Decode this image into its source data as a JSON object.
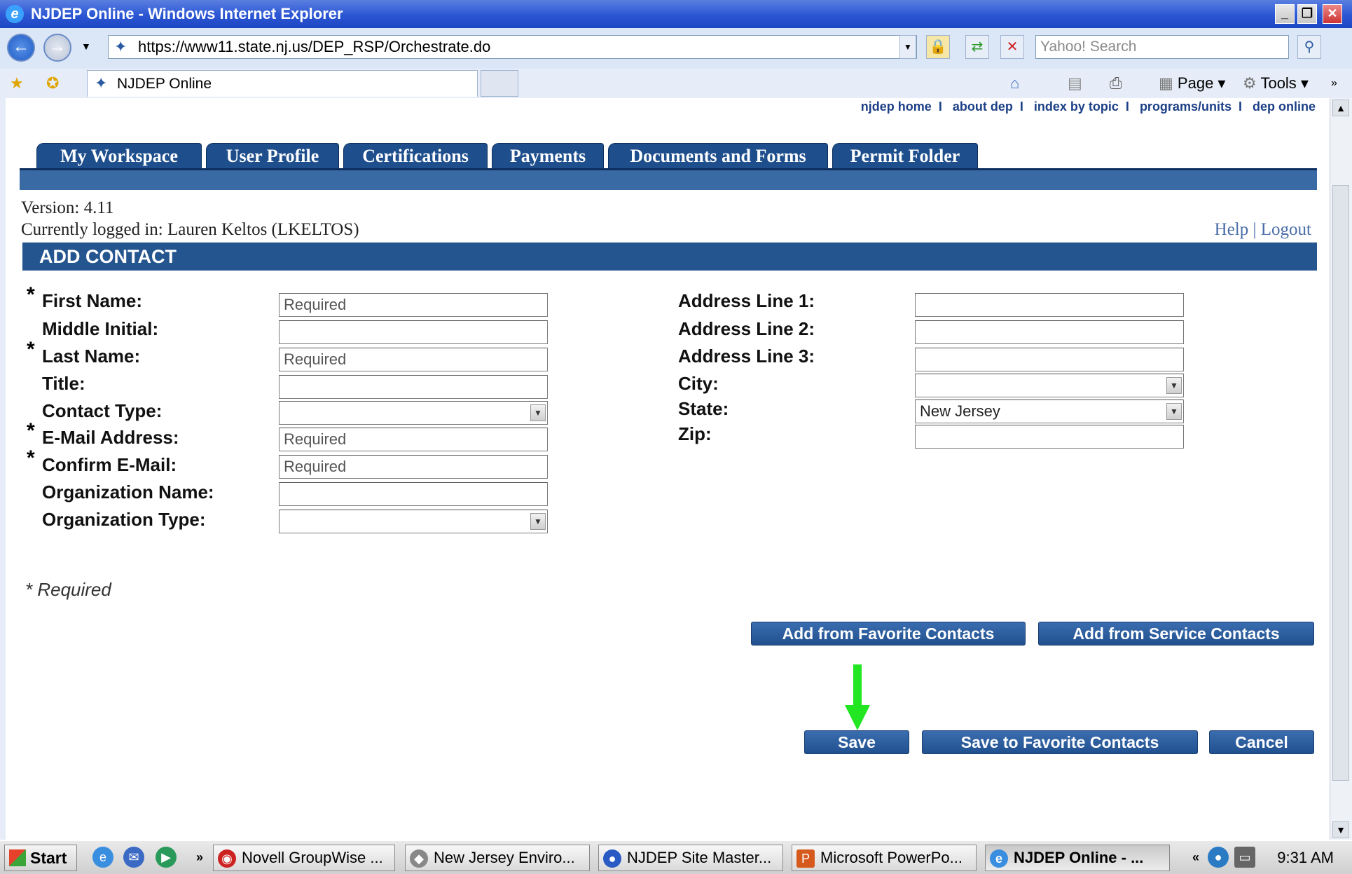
{
  "window": {
    "title": "NJDEP Online - Windows Internet Explorer",
    "minimize": "_",
    "restore": "❐",
    "close": "✕"
  },
  "browser": {
    "url": "https://www11.state.nj.us/DEP_RSP/Orchestrate.do",
    "search_placeholder": "Yahoo! Search",
    "tab_title": "NJDEP Online",
    "page_menu": "Page",
    "tools_menu": "Tools"
  },
  "top_links": [
    "njdep home",
    "about dep",
    "index by topic",
    "programs/units",
    "dep online"
  ],
  "nav_tabs": [
    "My Workspace",
    "User Profile",
    "Certifications",
    "Payments",
    "Documents and Forms",
    "Permit Folder"
  ],
  "session": {
    "version": "Version: 4.11",
    "logged_in": "Currently logged in: Lauren Keltos (LKELTOS)",
    "help": "Help",
    "separator": "|",
    "logout": "Logout"
  },
  "form": {
    "header": "ADD CONTACT",
    "left_fields": [
      {
        "label": "First Name:",
        "value": "Required",
        "required": true
      },
      {
        "label": "Middle Initial:",
        "value": "",
        "required": false
      },
      {
        "label": "Last Name:",
        "value": "Required",
        "required": true
      },
      {
        "label": "Title:",
        "value": "",
        "required": false
      },
      {
        "label": "Contact Type:",
        "value": "",
        "required": false
      },
      {
        "label": "E-Mail Address:",
        "value": "Required",
        "required": true
      },
      {
        "label": "Confirm E-Mail:",
        "value": "Required",
        "required": true
      },
      {
        "label": "Organization Name:",
        "value": "",
        "required": false
      },
      {
        "label": "Organization Type:",
        "value": "",
        "required": false
      }
    ],
    "right_fields": [
      {
        "label": "Address Line 1:",
        "value": ""
      },
      {
        "label": "Address Line 2:",
        "value": ""
      },
      {
        "label": "Address Line 3:",
        "value": ""
      },
      {
        "label": "City:",
        "value": ""
      },
      {
        "label": "State:",
        "value": "New Jersey"
      },
      {
        "label": "Zip:",
        "value": ""
      }
    ],
    "required_star": "*",
    "required_note": "* Required"
  },
  "buttons": {
    "add_favorite": "Add from Favorite Contacts",
    "add_service": "Add from Service Contacts",
    "save": "Save",
    "save_favorite": "Save to Favorite Contacts",
    "cancel": "Cancel"
  },
  "taskbar": {
    "start": "Start",
    "items": [
      "Novell GroupWise ...",
      "New Jersey Enviro...",
      "NJDEP Site Master...",
      "Microsoft PowerPo...",
      "NJDEP Online - ..."
    ],
    "clock": "9:31 AM"
  },
  "colors": {
    "nav_blue": "#1e4f8c",
    "header_blue": "#24558f",
    "link_blue": "#1c3f86",
    "arrow_green": "#22e622"
  }
}
